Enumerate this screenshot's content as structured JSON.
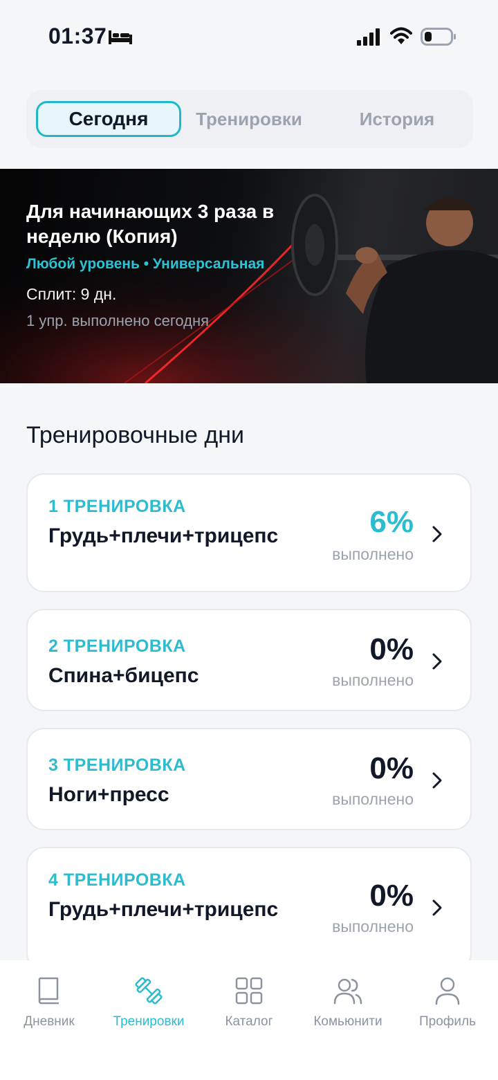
{
  "status": {
    "time": "01:37"
  },
  "tabs": [
    {
      "label": "Сегодня",
      "active": true
    },
    {
      "label": "Тренировки",
      "active": false
    },
    {
      "label": "История",
      "active": false
    }
  ],
  "program": {
    "title": "Для начинающих 3 раза в неделю (Копия)",
    "meta": "Любой уровень • Универсальная",
    "split": "Сплит: 9 дн.",
    "done_today": "1 упр. выполнено сегодня"
  },
  "section_title": "Тренировочные дни",
  "days": [
    {
      "label": "1 ТРЕНИРОВКА",
      "name": "Грудь+плечи+трицепс",
      "percent": "6%",
      "progress": 0.06,
      "status": "выполнено",
      "accent": "#2cbccf"
    },
    {
      "label": "2 ТРЕНИРОВКА",
      "name": "Спина+бицепс",
      "percent": "0%",
      "progress": 0,
      "status": "выполнено",
      "accent": "#111827"
    },
    {
      "label": "3 ТРЕНИРОВКА",
      "name": "Ноги+пресс",
      "percent": "0%",
      "progress": 0,
      "status": "выполнено",
      "accent": "#111827"
    },
    {
      "label": "4 ТРЕНИРОВКА",
      "name": "Грудь+плечи+трицепс",
      "percent": "0%",
      "progress": 0,
      "status": "выполнено",
      "accent": "#111827"
    }
  ],
  "bottom_nav": [
    {
      "label": "Дневник",
      "icon": "book-icon",
      "active": false
    },
    {
      "label": "Тренировки",
      "icon": "dumbbell-icon",
      "active": true
    },
    {
      "label": "Каталог",
      "icon": "grid-icon",
      "active": false
    },
    {
      "label": "Комьюнити",
      "icon": "users-icon",
      "active": false
    },
    {
      "label": "Профиль",
      "icon": "profile-icon",
      "active": false
    }
  ],
  "colors": {
    "accent": "#2cbccf",
    "text": "#111827",
    "muted": "#9ca3af"
  }
}
